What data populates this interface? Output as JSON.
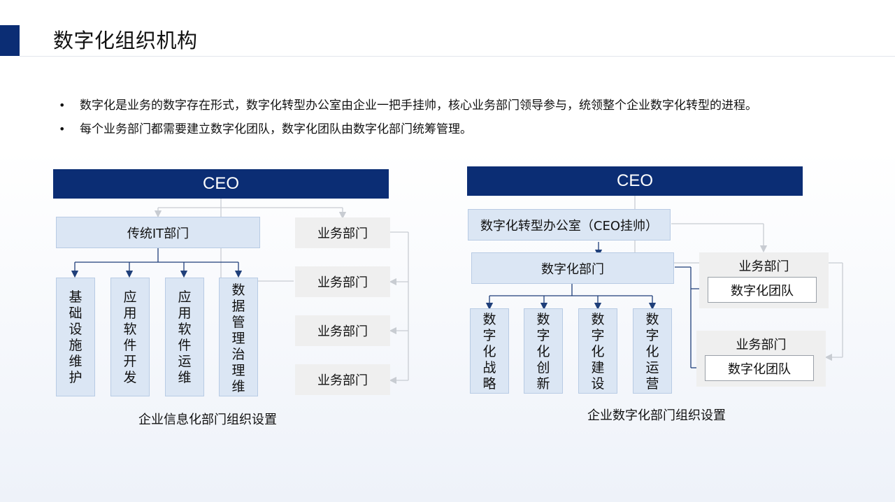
{
  "page": {
    "title": "数字化组织机构",
    "bullets": [
      "数字化是业务的数字存在形式，数字化转型办公室由企业一把手挂帅，核心业务部门领导参与，统领整个企业数字化转型的进程。",
      "每个业务部门都需要建立数字化团队，数字化团队由数字化部门统筹管理。"
    ],
    "bullet_symbol": "•"
  },
  "left_chart": {
    "ceo": "CEO",
    "it_dept": "传统IT部门",
    "it_units": [
      [
        "基",
        "础",
        "设",
        "施",
        "维",
        "护"
      ],
      [
        "应",
        "用",
        "软",
        "件",
        "开",
        "发"
      ],
      [
        "应",
        "用",
        "软",
        "件",
        "运",
        "维"
      ],
      [
        "数",
        "据",
        "管",
        "理",
        "治",
        "理",
        "维"
      ]
    ],
    "business_depts": [
      "业务部门",
      "业务部门",
      "业务部门",
      "业务部门"
    ],
    "caption": "企业信息化部门组织设置"
  },
  "right_chart": {
    "ceo": "CEO",
    "office": "数字化转型办公室（CEO挂帅）",
    "digital_dept": "数字化部门",
    "digital_units": [
      [
        "数",
        "字",
        "化",
        "战",
        "略"
      ],
      [
        "数",
        "字",
        "化",
        "创",
        "新"
      ],
      [
        "数",
        "字",
        "化",
        "建",
        "设"
      ],
      [
        "数",
        "字",
        "化",
        "运",
        "营"
      ]
    ],
    "business_groups": [
      {
        "label": "业务部门",
        "team": "数字化团队"
      },
      {
        "label": "业务部门",
        "team": "数字化团队"
      }
    ],
    "caption": "企业数字化部门组织设置"
  },
  "colors": {
    "primary": "#0b2d74",
    "light_blue": "#dbe6f4",
    "grey_box": "#efefef",
    "connector_dark": "#1f3f7a",
    "connector_light": "#c8ccd2"
  }
}
